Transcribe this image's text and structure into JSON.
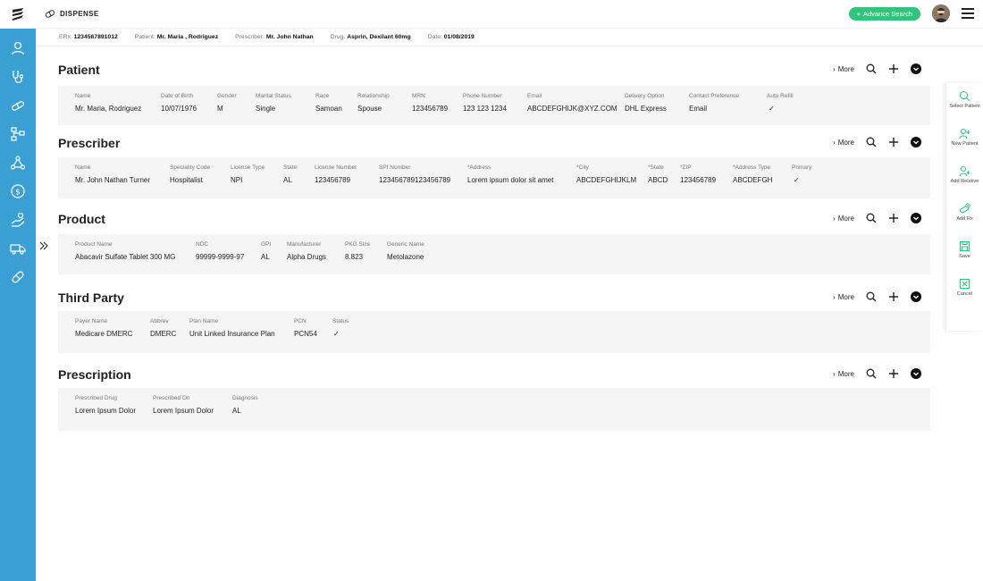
{
  "header": {
    "app_title": "DISPENSE",
    "advance_search_label": "Advance Search"
  },
  "colors": {
    "rail": "#3aa0d3",
    "accent_green": "#34c37d"
  },
  "rail": {
    "icons": [
      "user-icon",
      "stethoscope-icon",
      "pills-icon",
      "hierarchy-icon",
      "network-icon",
      "dollar-icon",
      "hand-pill-icon",
      "truck-icon",
      "bandage-icon"
    ]
  },
  "infobar": [
    {
      "label": "ERx:",
      "value": "1234567891012"
    },
    {
      "label": "Patient:",
      "value": "Mr. Maria , Rodriguez"
    },
    {
      "label": "Prescriber:",
      "value": "Mr. John Nathan"
    },
    {
      "label": "Drug:",
      "value": "Asprin, Dexilant 60mg"
    },
    {
      "label": "Date:",
      "value": "01/08/2019"
    }
  ],
  "more_label": "More",
  "sections": {
    "patient": {
      "title": "Patient",
      "fields": [
        {
          "label": "Name",
          "value": "Mr. Maria, Rodriguez"
        },
        {
          "label": "Date of Birth",
          "value": "10/07/1976"
        },
        {
          "label": "Gender",
          "value": "M"
        },
        {
          "label": "Marital Status",
          "value": "Single"
        },
        {
          "label": "Race",
          "value": "Samoan"
        },
        {
          "label": "Relationship",
          "value": "Spouse"
        },
        {
          "label": "MRN",
          "value": "123456789"
        },
        {
          "label": "Phone Number",
          "value": "123 123  1234"
        },
        {
          "label": "Email",
          "value": "ABCDEFGHIJK@XYZ.COM"
        },
        {
          "label": "Delivery Option",
          "value": "DHL Express"
        },
        {
          "label": "Contact Preference",
          "value": "Email"
        },
        {
          "label": "Auto Refill",
          "value": "✓"
        }
      ]
    },
    "prescriber": {
      "title": "Prescriber",
      "fields": [
        {
          "label": "Name",
          "value": "Mr. John Nathan Turner"
        },
        {
          "label": "Speciality Code",
          "value": "Hospitalist"
        },
        {
          "label": "License Type",
          "value": "NPI"
        },
        {
          "label": "State",
          "value": "AL"
        },
        {
          "label": "License Number",
          "value": "123456789"
        },
        {
          "label": "SPI Number",
          "value": "123456789123456789"
        },
        {
          "label": "*Address",
          "value": "Lorem ipsum dolor sit amet"
        },
        {
          "label": "*City",
          "value": "ABCDEFGHIJKLM"
        },
        {
          "label": "*State",
          "value": "ABCD"
        },
        {
          "label": "*ZIP",
          "value": "123456789"
        },
        {
          "label": "*Address Type",
          "value": "ABCDEFGH"
        },
        {
          "label": "Primary",
          "value": "✓"
        }
      ]
    },
    "product": {
      "title": "Product",
      "fields": [
        {
          "label": "Product Name",
          "value": "Abacavir Sulfate Tablet 300 MG"
        },
        {
          "label": "NDC",
          "value": "99999-9999-97"
        },
        {
          "label": "GPI",
          "value": "AL"
        },
        {
          "label": "Manufacturer",
          "value": "Alpha Drugs"
        },
        {
          "label": "PKG Size",
          "value": "8.823"
        },
        {
          "label": "Generic Name",
          "value": "Metolazone"
        }
      ]
    },
    "third_party": {
      "title": "Third Party",
      "fields": [
        {
          "label": "Payer Name",
          "value": "Medicare DMERC"
        },
        {
          "label": "Abbrev",
          "value": "DMERC"
        },
        {
          "label": "Plan Name",
          "value": "Unit Linked Insurance Plan"
        },
        {
          "label": "PCN",
          "value": "PCN54"
        },
        {
          "label": "Status",
          "value": "✓"
        }
      ]
    },
    "prescription": {
      "title": "Prescription",
      "fields": [
        {
          "label": "Prescribed Drug",
          "value": "Lorem Ipsum Dolor"
        },
        {
          "label": "Prescribed On",
          "value": "Lorem Ipsum Dolor"
        },
        {
          "label": "Diagnosis",
          "value": "AL"
        }
      ]
    }
  },
  "right_panel": [
    {
      "icon": "search-user-icon",
      "label": "Select Patient"
    },
    {
      "icon": "add-user-icon",
      "label": "New Patient"
    },
    {
      "icon": "add-relative-icon",
      "label": "Add Relative"
    },
    {
      "icon": "add-rx-icon",
      "label": "Add Rx"
    },
    {
      "icon": "save-icon",
      "label": "Save"
    },
    {
      "icon": "cancel-icon",
      "label": "Cancel"
    }
  ]
}
